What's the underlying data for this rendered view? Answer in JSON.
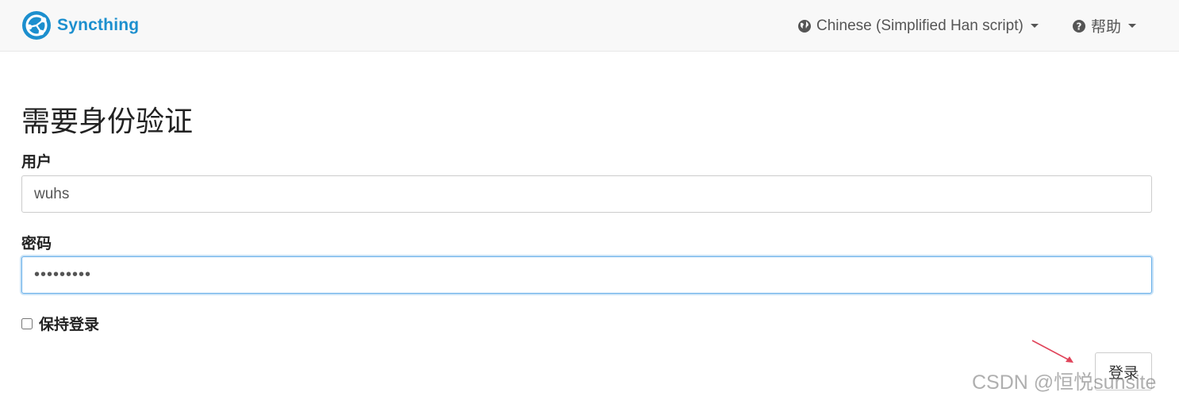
{
  "navbar": {
    "brand": "Syncthing",
    "language": {
      "label": "Chinese (Simplified Han script)",
      "icon": "globe-icon"
    },
    "help": {
      "label": "帮助",
      "icon": "question-circle-icon"
    }
  },
  "form": {
    "title": "需要身份验证",
    "user_label": "用户",
    "user_value": "wuhs",
    "password_label": "密码",
    "password_value": "•••••••••",
    "remember_label": "保持登录",
    "remember_checked": false,
    "submit_label": "登录"
  },
  "watermark": "CSDN @恒悦sunsite",
  "colors": {
    "brand": "#1c8fce",
    "focus": "#66afe9",
    "annotation_arrow": "#e0445a"
  }
}
